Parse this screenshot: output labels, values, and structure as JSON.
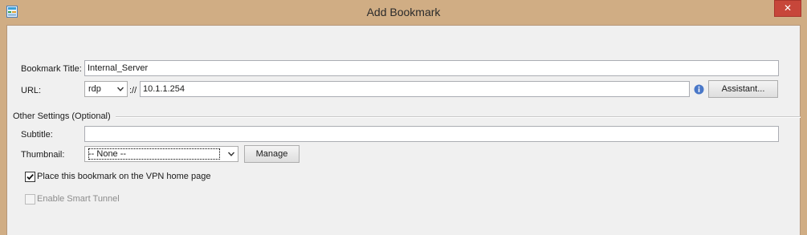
{
  "window": {
    "title": "Add Bookmark",
    "close_label": "✕"
  },
  "form": {
    "bookmark_title_label": "Bookmark Title:",
    "bookmark_title_value": "Internal_Server",
    "url_label": "URL:",
    "url_scheme": "rdp",
    "url_separator": "://",
    "url_value": "10.1.1.254",
    "assistant_button": "Assistant...",
    "other_settings_label": "Other Settings (Optional)",
    "subtitle_label": "Subtitle:",
    "subtitle_value": "",
    "thumbnail_label": "Thumbnail:",
    "thumbnail_value": "-- None --",
    "manage_button": "Manage",
    "vpn_home_label": "Place this bookmark on the VPN home page",
    "vpn_home_checked": true,
    "smart_tunnel_label": "Enable Smart Tunnel",
    "smart_tunnel_checked": false
  },
  "colors": {
    "title_bar": "#d0ad84",
    "close_button": "#c7463a",
    "dialog_bg": "#f0f0f0",
    "info_icon": "#4a78c8"
  },
  "icons": [
    "app-icon",
    "close-icon",
    "chevron-down-icon",
    "info-icon",
    "checkmark-icon"
  ]
}
